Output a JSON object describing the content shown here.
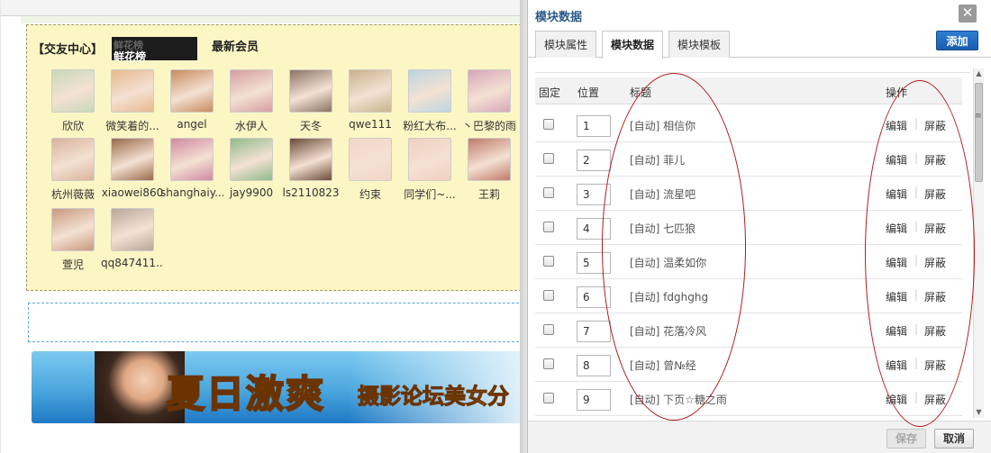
{
  "left": {
    "box_title": "【交友中心】",
    "tab_flowers": "鲜花榜",
    "tab_flowers_ghost": "鲜花榜",
    "tab_new_members": "最新会员",
    "members": [
      {
        "name": "欣欣",
        "color": "#c9d9b8"
      },
      {
        "name": "微笑着的...",
        "color": "#e7b98f"
      },
      {
        "name": "angel",
        "color": "#c88b5e"
      },
      {
        "name": "水伊人",
        "color": "#d59da0"
      },
      {
        "name": "天冬",
        "color": "#8a7464"
      },
      {
        "name": "qwe111",
        "color": "#c7b38d"
      },
      {
        "name": "粉红大布...",
        "color": "#bcd6e2"
      },
      {
        "name": "丶巴黎的雨",
        "color": "#d6a7b8"
      },
      {
        "name": "杭州薇薇",
        "color": "#d9b39b"
      },
      {
        "name": "xiaowei860",
        "color": "#9a6a4a"
      },
      {
        "name": "shanghaiy...",
        "color": "#d08aa0"
      },
      {
        "name": "jay9900",
        "color": "#8fbb8a"
      },
      {
        "name": "ls2110823",
        "color": "#6a4b38"
      },
      {
        "name": "约束",
        "color": "#f2d6c7"
      },
      {
        "name": "同学们~...",
        "color": "#f0d0c0"
      },
      {
        "name": "王莉",
        "color": "#c07a68"
      },
      {
        "name": "萱児",
        "color": "#c89a80"
      },
      {
        "name": "qq847411...",
        "color": "#b8a89a"
      }
    ],
    "banner_main": "夏日激爽",
    "banner_sub": "摄影论坛美女分"
  },
  "dialog": {
    "title": "模块数据",
    "close_glyph": "✕",
    "tabs": [
      "模块属性",
      "模块数据",
      "模块模板"
    ],
    "active_tab": "模块数据",
    "add_label": "添加",
    "columns": {
      "fixed": "固定",
      "position": "位置",
      "title": "标题",
      "actions": "操作"
    },
    "rows": [
      {
        "pos": "1",
        "title": "[自动] 相信你"
      },
      {
        "pos": "2",
        "title": "[自动] 菲儿"
      },
      {
        "pos": "3",
        "title": "[自动] 流星吧"
      },
      {
        "pos": "4",
        "title": "[自动] 七匹狼"
      },
      {
        "pos": "5",
        "title": "[自动] 温柔如你"
      },
      {
        "pos": "6",
        "title": "[自动] fdghghg"
      },
      {
        "pos": "7",
        "title": "[自动] 花落冷风"
      },
      {
        "pos": "8",
        "title": "[自动] 曾№经"
      },
      {
        "pos": "9",
        "title": "[自动] 下页☆糖之雨"
      }
    ],
    "edit_label": "编辑",
    "separator": "|",
    "mask_label": "屏蔽",
    "save_label": "保存",
    "cancel_label": "取消",
    "scroll_up_glyph": "▲",
    "scroll_down_glyph": "▼",
    "scroll_grip_glyph": "≡"
  },
  "colors": {
    "annotation_red": "#b01a1a",
    "add_button_blue": "#1b5cad",
    "dialog_title": "#2b5a8a",
    "friend_box_bg": "#fcf6c4"
  }
}
